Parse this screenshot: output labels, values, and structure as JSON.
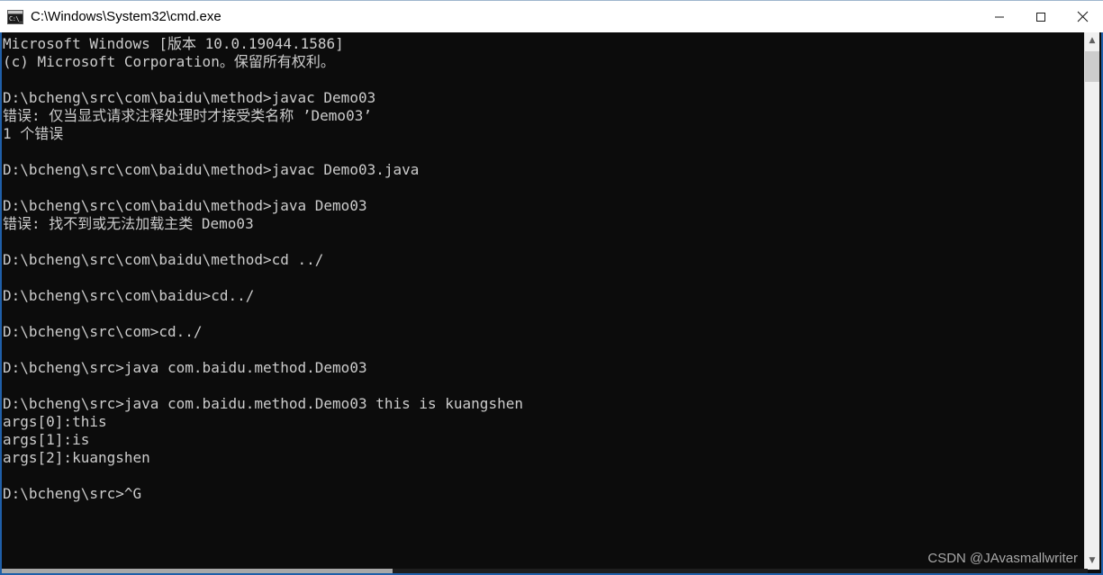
{
  "window": {
    "title": "C:\\Windows\\System32\\cmd.exe",
    "icon": "cmd-console-icon",
    "icon_glyph": "C:\\_",
    "border_color": "#1f5fa9",
    "titlebar_bg": "#ffffff",
    "console_bg": "#0c0c0c",
    "console_fg": "#cccccc"
  },
  "titlebar_buttons": {
    "minimize_label": "Minimize",
    "maximize_label": "Maximize",
    "close_label": "Close"
  },
  "console": {
    "lines": [
      "Microsoft Windows [版本 10.0.19044.1586]",
      "(c) Microsoft Corporation。保留所有权利。",
      "",
      "D:\\bcheng\\src\\com\\baidu\\method>javac Demo03",
      "错误: 仅当显式请求注释处理时才接受类名称 ’Demo03’",
      "1 个错误",
      "",
      "D:\\bcheng\\src\\com\\baidu\\method>javac Demo03.java",
      "",
      "D:\\bcheng\\src\\com\\baidu\\method>java Demo03",
      "错误: 找不到或无法加载主类 Demo03",
      "",
      "D:\\bcheng\\src\\com\\baidu\\method>cd ../",
      "",
      "D:\\bcheng\\src\\com\\baidu>cd../",
      "",
      "D:\\bcheng\\src\\com>cd../",
      "",
      "D:\\bcheng\\src>java com.baidu.method.Demo03",
      "",
      "D:\\bcheng\\src>java com.baidu.method.Demo03 this is kuangshen",
      "args[0]:this",
      "args[1]:is",
      "args[2]:kuangshen",
      "",
      "D:\\bcheng\\src>^G"
    ]
  },
  "scrollbars": {
    "vertical_up_arrow": "▲",
    "vertical_down_arrow": "▼"
  },
  "watermark": {
    "text": "CSDN @JAvasmallwriter"
  }
}
